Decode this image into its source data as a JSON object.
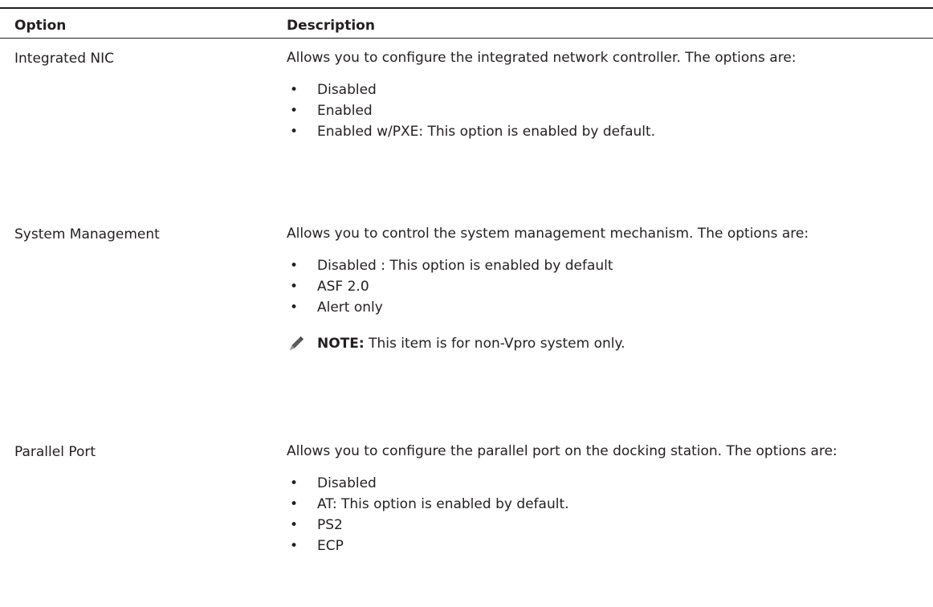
{
  "table": {
    "headers": {
      "option": "Option",
      "description": "Description"
    },
    "rows": [
      {
        "option": "Integrated NIC",
        "intro": "Allows you to configure the integrated network controller. The options are:",
        "items": [
          "Disabled",
          "Enabled",
          "Enabled w/PXE: This option is enabled by default."
        ]
      },
      {
        "option": "System Management",
        "intro": "Allows you to control the system management mechanism. The options are:",
        "items": [
          "Disabled : This option is enabled by default",
          "ASF 2.0",
          "Alert only"
        ],
        "note": {
          "label": "NOTE:",
          "text": " This item is for non-Vpro system only.",
          "icon": "pencil-note-icon"
        }
      },
      {
        "option": "Parallel Port",
        "intro": "Allows you to configure the parallel port on the docking station. The options are:",
        "items": [
          "Disabled",
          "AT: This option is enabled by default.",
          "PS2",
          "ECP"
        ]
      }
    ],
    "bullet": "•"
  }
}
